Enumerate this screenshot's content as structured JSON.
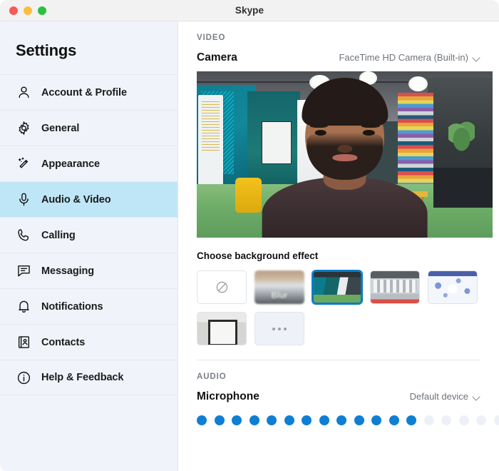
{
  "window": {
    "title": "Skype",
    "traffic_lights": [
      "close",
      "minimize",
      "zoom"
    ]
  },
  "sidebar": {
    "heading": "Settings",
    "items": [
      {
        "label": "Account & Profile",
        "icon": "person-icon",
        "active": false
      },
      {
        "label": "General",
        "icon": "gear-icon",
        "active": false
      },
      {
        "label": "Appearance",
        "icon": "magic-wand-icon",
        "active": false
      },
      {
        "label": "Audio & Video",
        "icon": "microphone-icon",
        "active": true
      },
      {
        "label": "Calling",
        "icon": "phone-icon",
        "active": false
      },
      {
        "label": "Messaging",
        "icon": "chat-bubble-icon",
        "active": false
      },
      {
        "label": "Notifications",
        "icon": "bell-icon",
        "active": false
      },
      {
        "label": "Contacts",
        "icon": "contact-card-icon",
        "active": false
      },
      {
        "label": "Help & Feedback",
        "icon": "info-circle-icon",
        "active": false
      }
    ]
  },
  "content": {
    "video_section_label": "VIDEO",
    "camera_row": {
      "name": "Camera",
      "selected_device": "FaceTime HD Camera (Built-in)",
      "chevron": "chevron-down-icon"
    },
    "preview": {
      "alt": "camera-preview-person-with-virtual-background"
    },
    "background_effect": {
      "title": "Choose background effect",
      "thumbnails": [
        {
          "id": "none",
          "label": "",
          "kind": "none",
          "selected": false
        },
        {
          "id": "blur",
          "label": "Blur",
          "kind": "blur",
          "selected": false
        },
        {
          "id": "office",
          "label": "",
          "kind": "office",
          "selected": true
        },
        {
          "id": "warehouse",
          "label": "",
          "kind": "warehouse",
          "selected": false
        },
        {
          "id": "winter",
          "label": "",
          "kind": "winter",
          "selected": false
        },
        {
          "id": "room",
          "label": "",
          "kind": "room",
          "selected": false
        },
        {
          "id": "more",
          "label": "",
          "kind": "more",
          "selected": false
        }
      ]
    },
    "audio_section_label": "AUDIO",
    "microphone_row": {
      "name": "Microphone",
      "selected_device": "Default device",
      "chevron": "chevron-down-icon"
    },
    "mic_level": {
      "total_dots": 19,
      "active_dots": 13,
      "active_color": "#0f7fd4",
      "inactive_color": "#edf1f7"
    }
  },
  "colors": {
    "accent": "#0f7fd4",
    "sidebar_bg": "#f0f4fa",
    "active_item_bg": "#bfe6f7",
    "titlebar_bg": "#f2f2f2"
  }
}
